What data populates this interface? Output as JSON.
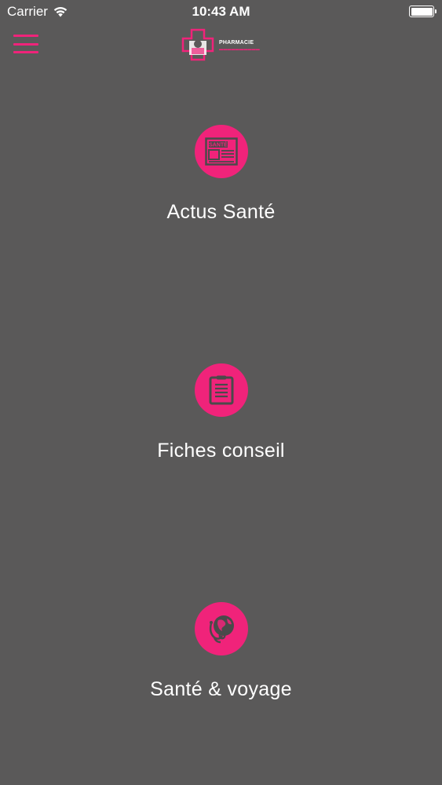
{
  "status_bar": {
    "carrier": "Carrier",
    "time": "10:43 AM"
  },
  "header": {
    "menu_icon": "hamburger-menu-icon",
    "logo_text": "PHARMACIE",
    "logo_icon": "pharmacy-cross-logo"
  },
  "colors": {
    "background": "#5a5959",
    "accent": "#f0237a",
    "text": "#ffffff"
  },
  "menu": {
    "items": [
      {
        "label": "Actus Santé",
        "icon": "newspaper-sante-icon",
        "icon_text": "SANTÉ"
      },
      {
        "label": "Fiches conseil",
        "icon": "clipboard-document-icon"
      },
      {
        "label": "Santé & voyage",
        "icon": "globe-stethoscope-icon"
      }
    ]
  }
}
